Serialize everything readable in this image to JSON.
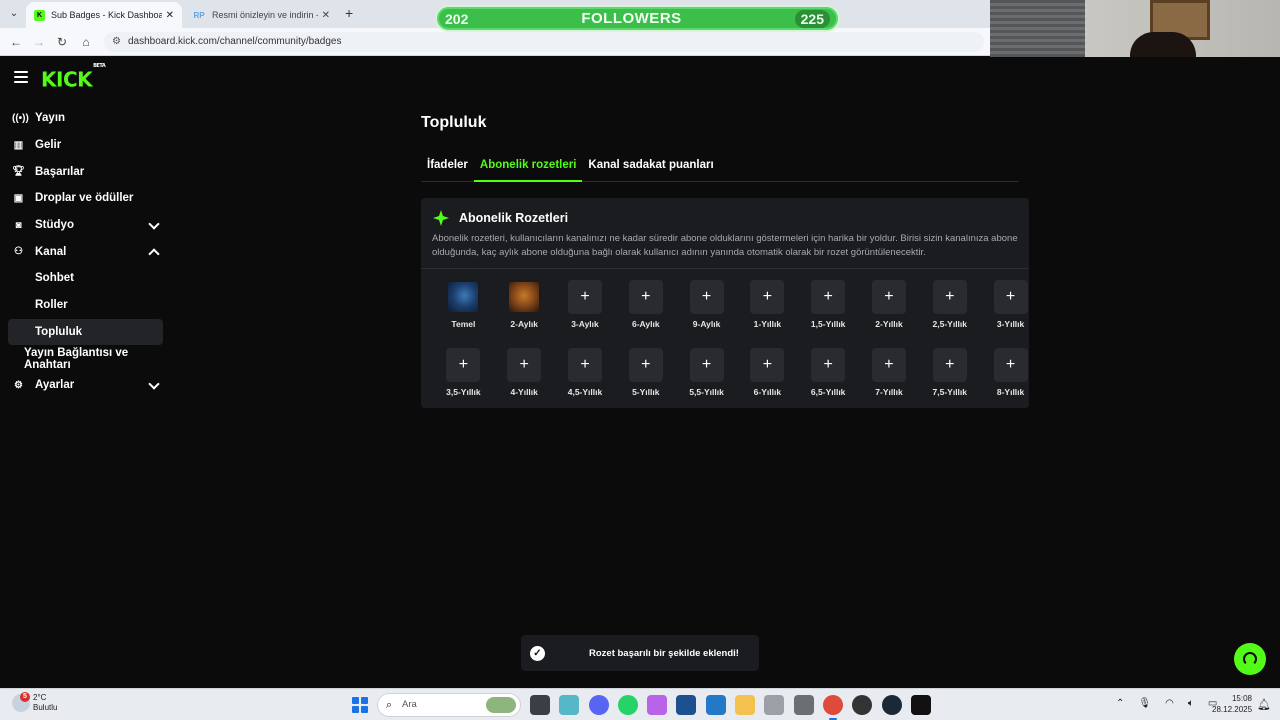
{
  "browser": {
    "tabs": [
      {
        "title": "Sub Badges - Kick Dashboard",
        "favicon": "kick-icon",
        "active": true
      },
      {
        "title": "Resmi önizleyin ve indirin - Res",
        "favicon_text": "RP",
        "active": false
      }
    ],
    "url": "dashboard.kick.com/channel/community/badges"
  },
  "overlay": {
    "followers_label": "FOLLOWERS",
    "current": "202",
    "goal": "225",
    "progress_fraction": 0.898,
    "color": "#3bbf4a"
  },
  "app": {
    "logo": "KICK",
    "logo_tag": "BETA",
    "accent": "#53fc18",
    "sidebar": {
      "items": [
        {
          "label": "Yayın",
          "icon": "broadcast-icon"
        },
        {
          "label": "Gelir",
          "icon": "chart-icon"
        },
        {
          "label": "Başarılar",
          "icon": "trophy-icon"
        },
        {
          "label": "Droplar ve ödüller",
          "icon": "gift-icon"
        },
        {
          "label": "Stüdyo",
          "icon": "camera-icon",
          "expandable": true,
          "expanded": false
        },
        {
          "label": "Kanal",
          "icon": "users-icon",
          "expandable": true,
          "expanded": true
        },
        {
          "label": "Sohbet"
        },
        {
          "label": "Roller"
        },
        {
          "label": "Topluluk",
          "active": true
        },
        {
          "label": "Yayın Bağlantısı ve Anahtarı"
        },
        {
          "label": "Ayarlar",
          "icon": "gear-icon",
          "expandable": true,
          "expanded": false
        }
      ]
    },
    "page_title": "Topluluk",
    "tabs": [
      {
        "label": "İfadeler",
        "active": false
      },
      {
        "label": "Abonelik rozetleri",
        "active": true
      },
      {
        "label": "Kanal sadakat puanları",
        "active": false
      }
    ],
    "card": {
      "title": "Abonelik Rozetleri",
      "description": "Abonelik rozetleri, kullanıcıların kanalınızı ne kadar süredir abone olduklarını göstermeleri için harika bir yoldur. Birisi sizin kanalınıza abone olduğunda, kaç aylık abone olduğuna bağlı olarak kullanıcı adının yanında otomatik olarak bir rozet görüntülenecektir.",
      "badges": [
        {
          "label": "Temel",
          "state": "image-blue"
        },
        {
          "label": "2-Aylık",
          "state": "image-bear"
        },
        {
          "label": "3-Aylık",
          "state": "add"
        },
        {
          "label": "6-Aylık",
          "state": "add"
        },
        {
          "label": "9-Aylık",
          "state": "add"
        },
        {
          "label": "1-Yıllık",
          "state": "add"
        },
        {
          "label": "1,5-Yıllık",
          "state": "add"
        },
        {
          "label": "2-Yıllık",
          "state": "add"
        },
        {
          "label": "2,5-Yıllık",
          "state": "add"
        },
        {
          "label": "3-Yıllık",
          "state": "add"
        },
        {
          "label": "3,5-Yıllık",
          "state": "add"
        },
        {
          "label": "4-Yıllık",
          "state": "add"
        },
        {
          "label": "4,5-Yıllık",
          "state": "add"
        },
        {
          "label": "5-Yıllık",
          "state": "add"
        },
        {
          "label": "5,5-Yıllık",
          "state": "add"
        },
        {
          "label": "6-Yıllık",
          "state": "add"
        },
        {
          "label": "6,5-Yıllık",
          "state": "add"
        },
        {
          "label": "7-Yıllık",
          "state": "add"
        },
        {
          "label": "7,5-Yıllık",
          "state": "add"
        },
        {
          "label": "8-Yıllık",
          "state": "add"
        }
      ],
      "add_symbol": "+"
    },
    "toast": {
      "message": "Rozet başarılı bir şekilde eklendi!"
    }
  },
  "taskbar": {
    "weather": {
      "temp": "2°C",
      "condition": "Bulutlu",
      "badge": "5"
    },
    "search_placeholder": "Ara",
    "clock": {
      "time": "15:08",
      "date": "28.12.2025"
    }
  }
}
